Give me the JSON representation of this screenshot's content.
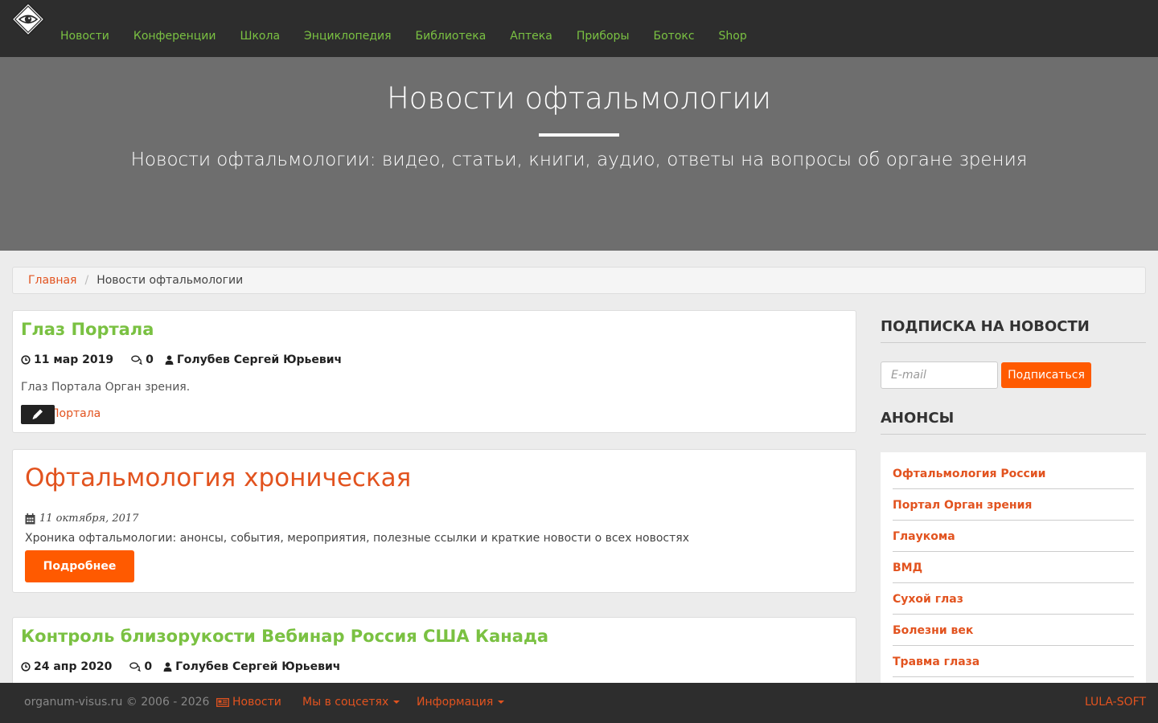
{
  "nav": {
    "items": [
      "Новости",
      "Конференции",
      "Школа",
      "Энциклопедия",
      "Библиотека",
      "Аптека",
      "Приборы",
      "Ботокс",
      "Shop"
    ]
  },
  "hero": {
    "title": "Новости офтальмологии",
    "subtitle": "Новости офтальмологии: видео, статьи, книги, аудио, ответы на вопросы об органе зрения"
  },
  "breadcrumb": {
    "home": "Главная",
    "current": "Новости офтальмологии"
  },
  "posts": [
    {
      "title": "Глаз Портала",
      "date": "11 мар 2019",
      "comments": "0",
      "author": "Голубев Сергей Юрьевич",
      "excerpt": "Глаз Портала Орган зрения.",
      "tag_link": "Портала"
    },
    {
      "title": "Офтальмология хроническая",
      "date": "11 октября, 2017",
      "text": "Хроника офтальмологии: анонсы, события, мероприятия, полезные ссылки и краткие новости о всех новостях",
      "more_label": "Подробнее"
    },
    {
      "title": "Контроль близорукости Вебинар Россия США Канада",
      "date": "24 апр 2020",
      "comments": "0",
      "author": "Голубев Сергей Юрьевич"
    }
  ],
  "sidebar": {
    "subscribe_heading": "ПОДПИСКА НА НОВОСТИ",
    "email_placeholder": "E-mail",
    "subscribe_label": "Подписаться",
    "announce_heading": "АНОНСЫ",
    "links": [
      "Офтальмология России",
      "Портал Орган зрения",
      "Глаукома",
      "ВМД",
      "Сухой глаз",
      "Болезни век",
      "Травма глаза"
    ]
  },
  "footer": {
    "copyright": "organum-visus.ru © 2006 - 2026",
    "news_label": "Новости",
    "social_label": "Мы в соцсетях",
    "info_label": "Информация",
    "developer": "LULA-SOFT"
  },
  "colors": {
    "accent_orange": "#e2531f",
    "button_orange": "#ff5a00",
    "nav_green": "#7ac142",
    "dark_bar": "#2d2d2d",
    "hero_gray": "#6e6e6e"
  },
  "icons": {
    "logo": "eye-logo-icon",
    "date": "clock-icon",
    "comments": "comments-icon",
    "author": "user-icon",
    "edit": "pencil-icon",
    "calendar": "calendar-icon",
    "footer_news": "newspaper-icon"
  }
}
